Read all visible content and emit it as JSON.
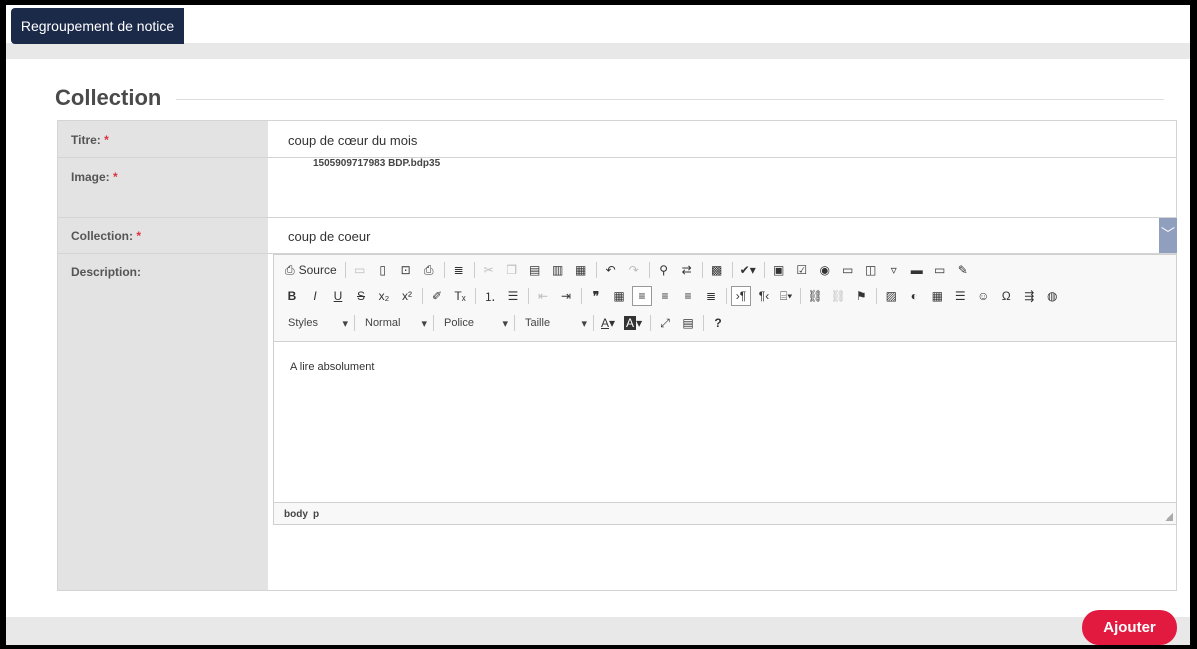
{
  "tab": {
    "label": "Regroupement de notice"
  },
  "section": {
    "title": "Collection"
  },
  "form": {
    "titre": {
      "label": "Titre:",
      "required": "*",
      "value": "coup de cœur du mois"
    },
    "image": {
      "label": "Image:",
      "required": "*",
      "value": "1505909717983 BDP.bdp35"
    },
    "collection": {
      "label": "Collection:",
      "required": "*",
      "value": "coup de coeur",
      "arrow": "﹀"
    },
    "description": {
      "label": "Description:"
    }
  },
  "editor": {
    "source_label": "Source",
    "styles": "Styles",
    "format": "Normal",
    "font": "Police",
    "size": "Taille",
    "content": "A lire absolument",
    "path": [
      "body",
      "p"
    ],
    "help": "?"
  },
  "actions": {
    "submit": "Ajouter"
  },
  "colors": {
    "accent": "#e31a3f",
    "tab": "#1c2a4a",
    "select_arrow": "#8f9fbd"
  }
}
